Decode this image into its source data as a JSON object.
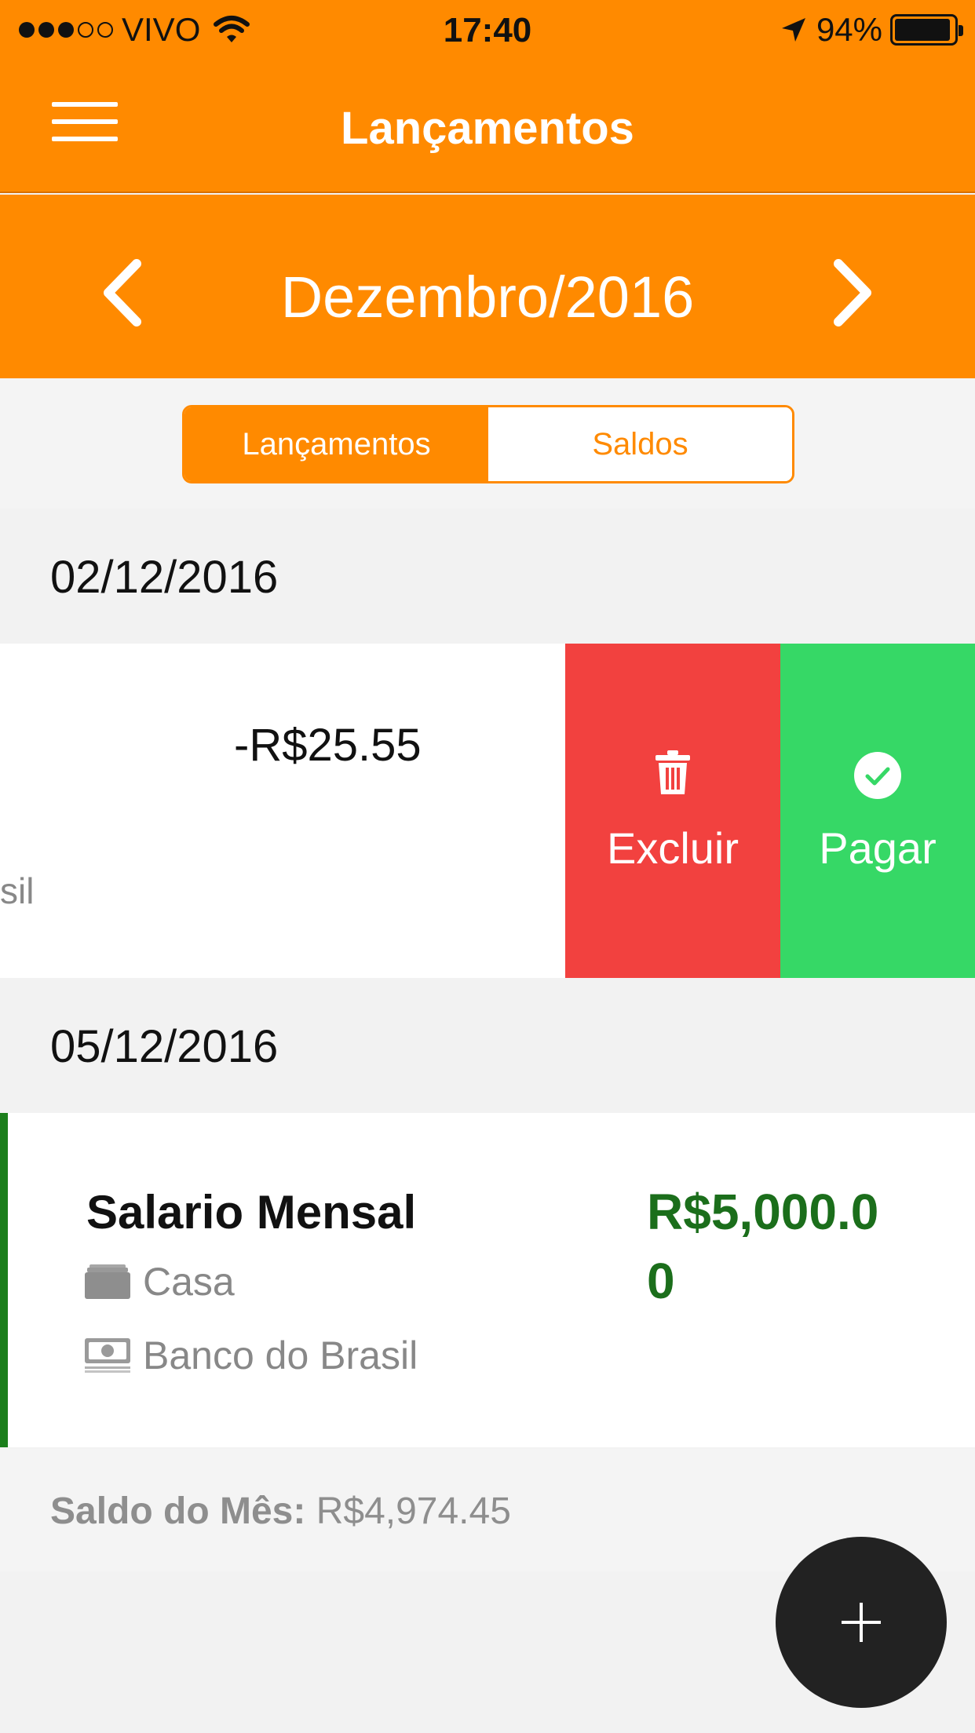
{
  "status_bar": {
    "carrier": "VIVO",
    "time": "17:40",
    "battery_percent": "94%",
    "battery_level": 0.94,
    "signal_bars_filled": 3,
    "signal_bars_total": 5
  },
  "navbar": {
    "title": "Lançamentos",
    "menu_icon": "hamburger-menu-icon"
  },
  "month_selector": {
    "label": "Dezembro/2016",
    "prev_icon": "chevron-left-icon",
    "next_icon": "chevron-right-icon"
  },
  "segmented_control": {
    "tabs": [
      {
        "label": "Lançamentos",
        "active": true
      },
      {
        "label": "Saldos",
        "active": false
      }
    ]
  },
  "groups": [
    {
      "date": "02/12/2016",
      "entries": [
        {
          "amount": "-R$25.55",
          "account_fragment": "sil",
          "actions": [
            {
              "label": "Excluir",
              "icon": "trash-icon",
              "color": "#f2413f"
            },
            {
              "label": "Pagar",
              "icon": "check-circle-icon",
              "color": "#36d866"
            }
          ]
        }
      ]
    },
    {
      "date": "05/12/2016",
      "entries": [
        {
          "title": "Salario Mensal",
          "category": "Casa",
          "category_icon": "wallet-icon",
          "account": "Banco do Brasil",
          "account_icon": "money-icon",
          "amount": "R$5,000.00",
          "amount_color": "#1b6e1b"
        }
      ]
    }
  ],
  "summary": {
    "label": "Saldo do Mês:",
    "value": "R$4,974.45"
  },
  "fab": {
    "icon": "plus-icon"
  },
  "colors": {
    "accent": "#ff8a00",
    "delete": "#f2413f",
    "pay": "#36d866",
    "income": "#1b6e1b"
  }
}
